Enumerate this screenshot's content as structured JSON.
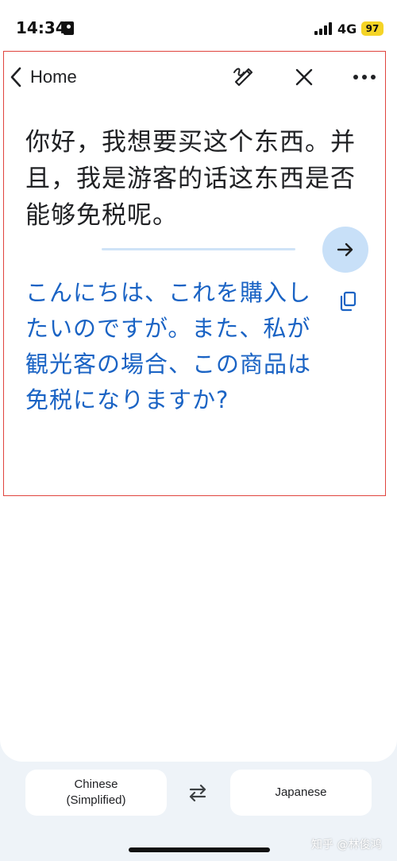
{
  "status_bar": {
    "time": "14:34",
    "network": "4G",
    "battery": "97",
    "icons": [
      "id-card-icon",
      "signal-bars-icon"
    ]
  },
  "header": {
    "back_label": "Home",
    "icons": [
      "chevron-left-icon",
      "handwriting-pen-icon",
      "close-icon",
      "more-vert-icon"
    ]
  },
  "source": {
    "text": "你好，我想要买这个东西。并且，我是游客的话这东西是否能够免税呢。"
  },
  "translation": {
    "text": "こんにちは、これを購入したいのですが。また、私が観光客の場合、この商品は免税になりますか?",
    "icons": [
      "arrow-right-icon",
      "copy-icon"
    ]
  },
  "languages": {
    "source": "Chinese\n(Simplified)",
    "target": "Japanese",
    "swap_icon": "swap-horiz-icon"
  },
  "watermark": "知乎 @林俊鸿",
  "colors": {
    "accent_blue": "#1a63c4",
    "fab_bg": "#c8e0f8",
    "highlight_border": "#e0443e",
    "battery": "#f5d426",
    "page_bg": "#eef3f8"
  }
}
